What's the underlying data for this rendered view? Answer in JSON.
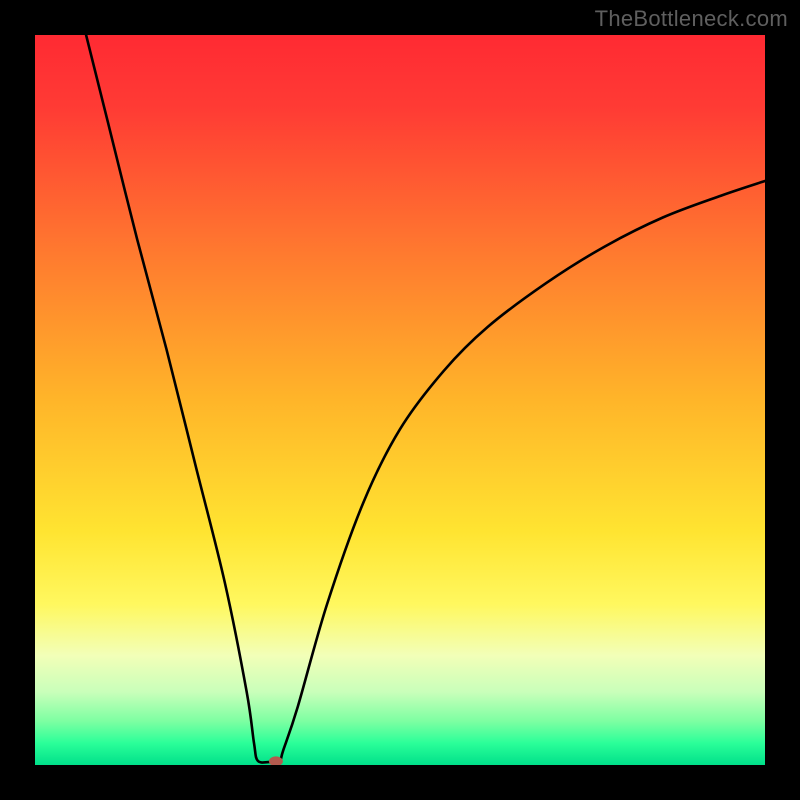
{
  "watermark": "TheBottleneck.com",
  "chart_data": {
    "type": "line",
    "title": "",
    "xlabel": "",
    "ylabel": "",
    "xlim": [
      0,
      100
    ],
    "ylim": [
      0,
      100
    ],
    "background_gradient_stops": [
      {
        "offset": 0.0,
        "color": "#ff2a33"
      },
      {
        "offset": 0.1,
        "color": "#ff3b34"
      },
      {
        "offset": 0.3,
        "color": "#ff7a2f"
      },
      {
        "offset": 0.5,
        "color": "#ffb529"
      },
      {
        "offset": 0.68,
        "color": "#ffe431"
      },
      {
        "offset": 0.78,
        "color": "#fff85f"
      },
      {
        "offset": 0.85,
        "color": "#f2ffb8"
      },
      {
        "offset": 0.9,
        "color": "#c9ffba"
      },
      {
        "offset": 0.94,
        "color": "#7dffa2"
      },
      {
        "offset": 0.97,
        "color": "#2bff99"
      },
      {
        "offset": 1.0,
        "color": "#00e08a"
      }
    ],
    "curve": {
      "description": "V-shaped bottleneck curve reaching minimum near x≈32",
      "points": [
        {
          "x": 7,
          "y": 100
        },
        {
          "x": 10,
          "y": 88
        },
        {
          "x": 14,
          "y": 72
        },
        {
          "x": 18,
          "y": 57
        },
        {
          "x": 22,
          "y": 41
        },
        {
          "x": 26,
          "y": 25
        },
        {
          "x": 29,
          "y": 10
        },
        {
          "x": 30,
          "y": 3
        },
        {
          "x": 30.5,
          "y": 0.6
        },
        {
          "x": 32,
          "y": 0.4
        },
        {
          "x": 33.5,
          "y": 0.6
        },
        {
          "x": 34,
          "y": 2
        },
        {
          "x": 36,
          "y": 8
        },
        {
          "x": 40,
          "y": 22
        },
        {
          "x": 45,
          "y": 36
        },
        {
          "x": 50,
          "y": 46
        },
        {
          "x": 56,
          "y": 54
        },
        {
          "x": 62,
          "y": 60
        },
        {
          "x": 70,
          "y": 66
        },
        {
          "x": 78,
          "y": 71
        },
        {
          "x": 86,
          "y": 75
        },
        {
          "x": 94,
          "y": 78
        },
        {
          "x": 100,
          "y": 80
        }
      ]
    },
    "marker": {
      "x": 33,
      "y": 0.5,
      "rx": 7,
      "ry": 5,
      "color": "#b35a4e"
    }
  }
}
